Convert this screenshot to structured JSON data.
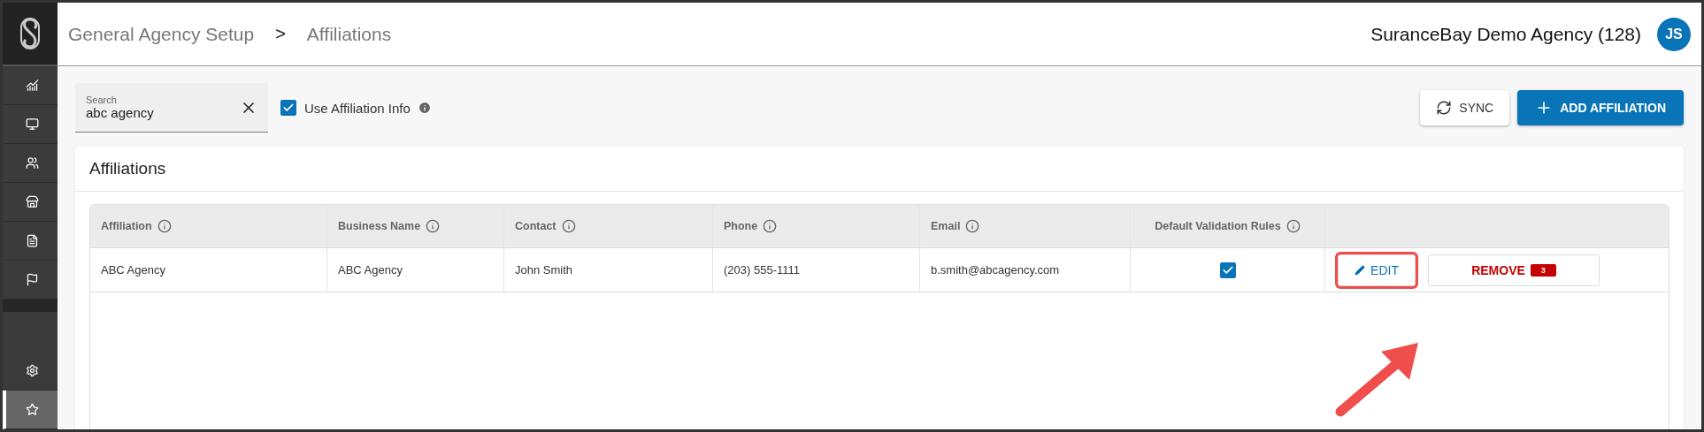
{
  "header": {
    "breadcrumb": [
      "General Agency Setup",
      "Affiliations"
    ],
    "separator": ">",
    "agency": "SuranceBay Demo Agency (128)",
    "avatar": "JS"
  },
  "sidebar": {
    "items": [
      {
        "selected": false
      },
      {
        "selected": false
      },
      {
        "selected": false
      },
      {
        "selected": false
      },
      {
        "selected": false
      },
      {
        "selected": false
      },
      {
        "selected": false
      },
      {
        "selected": true
      }
    ]
  },
  "search": {
    "label": "Search",
    "value": "abc agency"
  },
  "use_affiliation_info": {
    "label": "Use Affiliation Info",
    "checked": true
  },
  "buttons": {
    "sync": "SYNC",
    "add": "ADD AFFILIATION"
  },
  "card": {
    "title": "Affiliations"
  },
  "table": {
    "columns": [
      "Affiliation",
      "Business Name",
      "Contact",
      "Phone",
      "Email",
      "Default Validation Rules"
    ],
    "rows": [
      {
        "cells": [
          "ABC Agency",
          "ABC Agency",
          "John Smith",
          "(203) 555-1111",
          "b.smith@abcagency.com"
        ],
        "default_validation": true,
        "edit": "EDIT",
        "remove": "REMOVE",
        "remove_count": "3"
      }
    ]
  }
}
